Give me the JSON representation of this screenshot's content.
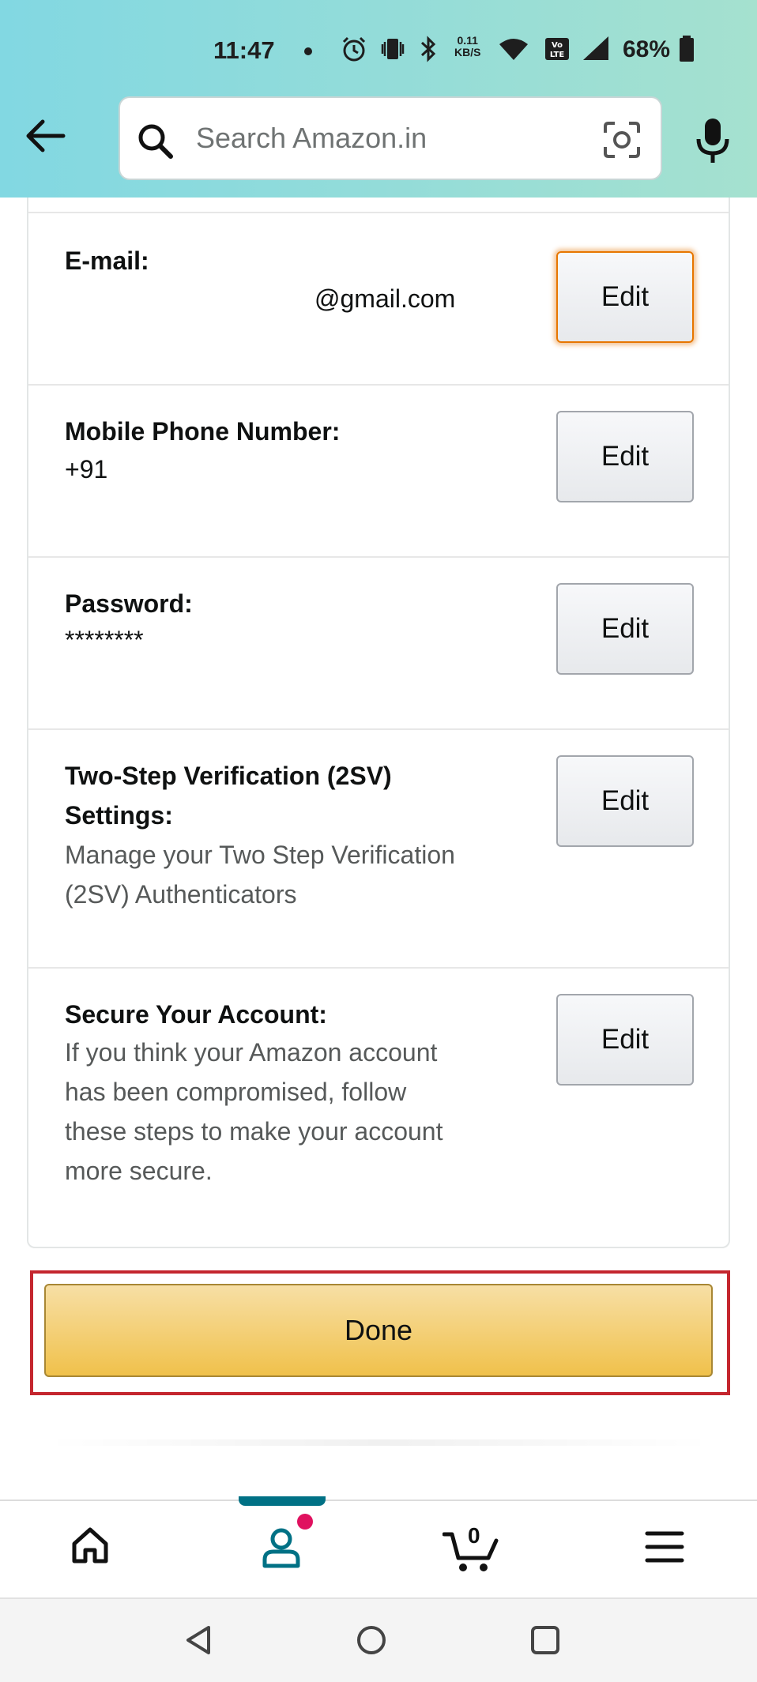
{
  "status_bar": {
    "time": "11:47",
    "net_speed_value": "0.11",
    "net_speed_unit": "KB/S",
    "volte_label": "Vo LTE",
    "battery": "68%"
  },
  "header": {
    "search_placeholder": "Search Amazon.in"
  },
  "settings": {
    "email": {
      "label": "E-mail:",
      "value": "@gmail.com",
      "button": "Edit"
    },
    "phone": {
      "label": "Mobile Phone Number:",
      "value": "+91",
      "button": "Edit"
    },
    "password": {
      "label": "Password:",
      "value": "********",
      "button": "Edit"
    },
    "two_step": {
      "label_line1": "Two-Step Verification (2SV)",
      "label_line2": "Settings:",
      "desc_line1": "Manage your Two Step Verification",
      "desc_line2": "(2SV) Authenticators",
      "button": "Edit"
    },
    "secure": {
      "label": "Secure Your Account:",
      "desc_line1": "If you think your Amazon account",
      "desc_line2": "has been compromised, follow",
      "desc_line3": "these steps to make your account",
      "desc_line4": "more secure.",
      "button": "Edit"
    }
  },
  "done_button": "Done",
  "bottom_nav": {
    "items": [
      "home-icon",
      "account-icon",
      "cart-icon",
      "menu-icon"
    ],
    "cart_count": "0",
    "active": "account",
    "accent_color": "#007185",
    "badge_color": "#e0115f"
  },
  "system_nav": [
    "back-triangle-icon",
    "home-circle-icon",
    "recents-square-icon"
  ]
}
